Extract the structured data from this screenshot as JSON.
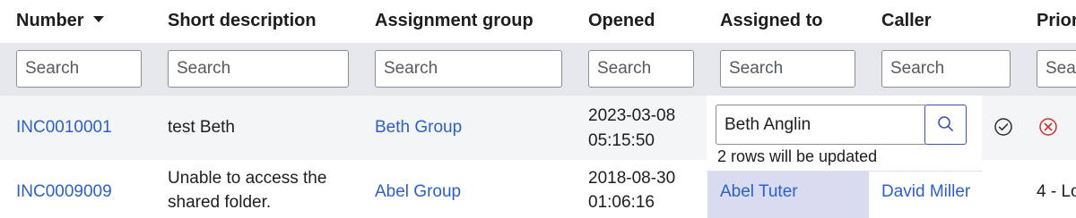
{
  "columns": {
    "number": "Number",
    "short_description": "Short description",
    "assignment_group": "Assignment group",
    "opened": "Opened",
    "assigned_to": "Assigned to",
    "caller": "Caller",
    "priority": "Prior"
  },
  "search_placeholders": {
    "number": "Search",
    "short_description": "Search",
    "assignment_group": "Search",
    "opened": "Search",
    "assigned_to": "Search",
    "caller": "Search",
    "priority": "Sear"
  },
  "rows": [
    {
      "number": "INC0010001",
      "short_description": "test Beth",
      "assignment_group": "Beth Group",
      "opened_date": "2023-03-08",
      "opened_time": "05:15:50"
    },
    {
      "number": "INC0009009",
      "short_description_line1": "Unable to access the",
      "short_description_line2": "shared folder.",
      "assignment_group": "Abel Group",
      "opened_date": "2018-08-30",
      "opened_time": "01:06:16",
      "assigned_to": "Abel Tuter",
      "caller": "David Miller",
      "priority": "4 - Lo"
    }
  ],
  "inline_editor": {
    "value": "Beth Anglin",
    "note": "2 rows will be updated"
  },
  "colors": {
    "link": "#2b5fc9",
    "selected_cell": "#d9dcf0",
    "confirm": "#2e2e2e",
    "cancel": "#d0312d"
  }
}
